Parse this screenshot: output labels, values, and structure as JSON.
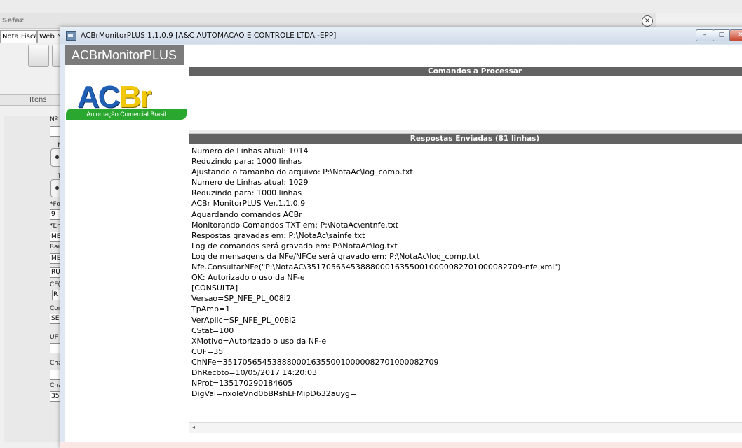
{
  "background_window": {
    "title": "Sefaz",
    "close_glyph": "×",
    "tabs": [
      "Nota Fiscal",
      "Web N"
    ],
    "itens_label": "Itens",
    "labels": [
      "Nº",
      "N",
      "T",
      "*Fo",
      "*En",
      "Rai",
      "CF(",
      "Con",
      "UF",
      "Cha",
      "Cha"
    ],
    "fields": [
      "9",
      "ME",
      "ME",
      "RU",
      "R",
      "SE",
      "",
      "",
      "35"
    ]
  },
  "window": {
    "title": "ACBrMonitorPLUS 1.1.0.9  [A&C AUTOMACAO E CONTROLE LTDA.-EPP]",
    "buttons": {
      "minimize": "–",
      "maximize": "□",
      "close": "✕"
    }
  },
  "app": {
    "header": "ACBrMonitorPLUS",
    "logo": {
      "word_ac": "AC",
      "word_br": "Br",
      "tagline": "Automação Comercial Brasil"
    }
  },
  "commands": {
    "header": "Comandos a Processar",
    "items": []
  },
  "responses": {
    "header": "Respostas Enviadas (81 linhas)",
    "lines": [
      "Numero de Linhas atual: 1014",
      "Reduzindo para: 1000 linhas",
      "Ajustando o tamanho do arquivo: P:\\NotaAc\\log_comp.txt",
      "Numero de Linhas atual: 1029",
      "Reduzindo para: 1000 linhas",
      "ACBr MonitorPLUS Ver.1.1.0.9",
      "Aguardando comandos ACBr",
      "Monitorando Comandos TXT em: P:\\NotaAc\\entnfe.txt",
      "Respostas gravadas em: P:\\NotaAc\\sainfe.txt",
      "Log de comandos será gravado em: P:\\NotaAc\\log.txt",
      "Log de mensagens da NFe/NFCe será gravado em: P:\\NotaAc\\log_comp.txt",
      "Nfe.ConsultarNFe(\"P:\\NotaAC\\35170565453888000163550010000082701000082709-nfe.xml\")",
      "OK: Autorizado o uso da NF-e",
      "[CONSULTA]",
      "Versao=SP_NFE_PL_008i2",
      "TpAmb=1",
      "VerAplic=SP_NFE_PL_008i2",
      "CStat=100",
      "XMotivo=Autorizado o uso da NF-e",
      "CUF=35",
      "ChNFe=35170565453888000163550010000082701000082709",
      "DhRecbto=10/05/2017 14:20:03",
      "NProt=135170290184605",
      "DigVal=nxoleVnd0bBRshLFMipD632auyg="
    ],
    "scroll_left_glyph": "◂"
  }
}
